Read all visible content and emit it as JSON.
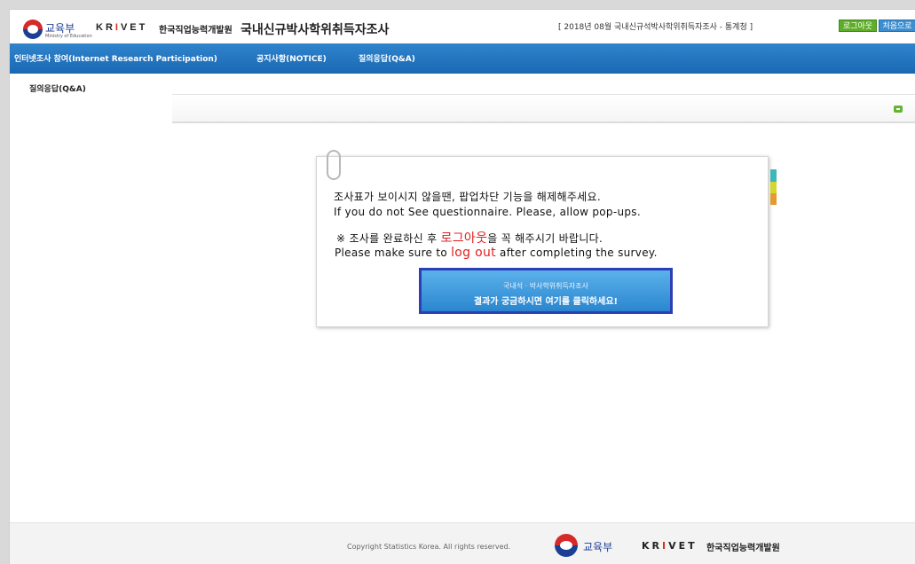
{
  "header": {
    "ministry": "교육부",
    "ministry_sub": "Ministry of Education",
    "krivet_pre": "KR",
    "krivet_i": "I",
    "krivet_post": "VET",
    "krivet_kr": "한국직업능력개발원",
    "site_title": "국내신규박사학위취득자조사",
    "survey_info": "[ 2018년 08월  국내신규석박사학위취득자조사 - 통계청 ]",
    "logout_label": "로그아웃",
    "home_label": "처음으로"
  },
  "nav": {
    "items": [
      {
        "label": "인터넷조사 참여(Internet Research Participation)"
      },
      {
        "label": "공지사항(NOTICE)"
      },
      {
        "label": "질의응답(Q&A)"
      }
    ]
  },
  "content": {
    "page_label": "질의응답(Q&A)"
  },
  "popup": {
    "line1": "조사표가 보이시지 않을땐, 팝업차단 기능을 해제해주세요.",
    "line2": "If you do not See questionnaire. Please, allow pop-ups.",
    "line3_pre": "※ 조사를 완료하신 후 ",
    "line3_red": "로그아웃",
    "line3_post": "을 꼭 해주시기 바랍니다.",
    "line4_pre": "Please make sure to ",
    "line4_red": "log out",
    "line4_post": " after completing the survey.",
    "cta_line1": "국내석 · 박사학위취득자조사",
    "cta_line2": "결과가 궁금하시면 여기를 클릭하세요!"
  },
  "footer": {
    "copyright": "Copyright Statistics Korea. All rights reserved.",
    "ministry": "교육부",
    "krivet_pre": "KR",
    "krivet_i": "I",
    "krivet_post": "VET",
    "krivet_kr": "한국직업능력개발원"
  },
  "colors": {
    "nav_blue": "#1a68b3",
    "accent_red": "#e02020",
    "logout_green": "#5fae2a",
    "home_blue": "#3c8ed1",
    "cta_border": "#2b3fb6"
  }
}
